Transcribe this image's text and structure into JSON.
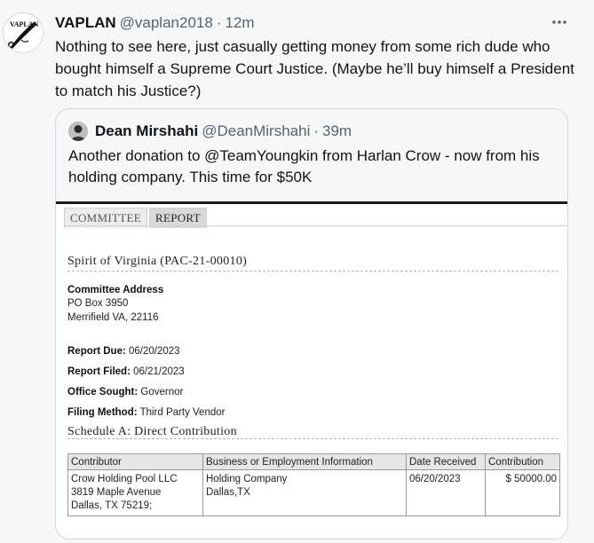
{
  "tweet": {
    "name": "VAPLAN",
    "handle": "@vaplan2018",
    "separator": "·",
    "time": "12m",
    "avatar_text": "VAPLAN",
    "more_icon": "more-horizontal-icon",
    "text": "Nothing to see here, just casually getting money from some rich dude who bought himself a Supreme Court Justice. (Maybe he’ll buy himself a President to match his Justice?)"
  },
  "quote": {
    "name": "Dean Mirshahi",
    "handle": "@DeanMirshahi",
    "separator": "·",
    "time": "39m",
    "text": "Another donation to @TeamYoungkin from Harlan Crow - now from his holding company. This time for $50K"
  },
  "document": {
    "tabs": [
      {
        "label": "COMMITTEE",
        "active": false
      },
      {
        "label": "REPORT",
        "active": true
      }
    ],
    "title": "Spirit of Virginia (PAC-21-00010)",
    "address_label": "Committee Address",
    "address_line1": "PO Box 3950",
    "address_line2": "Merrifield VA, 22116",
    "report_due_label": "Report Due:",
    "report_due": "06/20/2023",
    "report_filed_label": "Report Filed:",
    "report_filed": "06/21/2023",
    "office_label": "Office Sought:",
    "office": "Governor",
    "filing_label": "Filing Method:",
    "filing": "Third Party Vendor",
    "schedule_title": "Schedule A: Direct Contribution",
    "table": {
      "headers": [
        "Contributor",
        "Business or Employment Information",
        "Date Received",
        "Contribution"
      ],
      "rows": [
        {
          "contributor_line1": "Crow Holding Pool LLC",
          "contributor_line2": "3819 Maple Avenue",
          "contributor_line3": "Dallas, TX 75219;",
          "business_line1": "Holding Company",
          "business_line2": "Dallas,TX",
          "date": "06/20/2023",
          "amount": "$ 50000.00"
        }
      ]
    }
  }
}
